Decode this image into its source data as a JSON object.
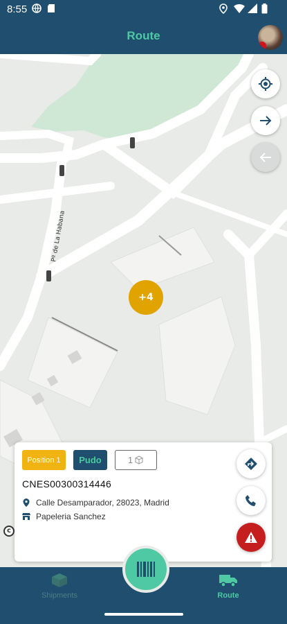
{
  "status_bar": {
    "time": "8:55"
  },
  "app_bar": {
    "title": "Route"
  },
  "map": {
    "street_label": "Pº de La Habana",
    "cluster_label": "+4"
  },
  "card": {
    "position_badge": "Position 1",
    "type_badge": "Pudo",
    "package_count": "1",
    "tracking_code": "CNES00300314446",
    "address": "Calle Desamparador, 28023, Madrid",
    "store_name": "Papeleria Sanchez"
  },
  "bottom_nav": {
    "items": [
      {
        "label": "Shipments",
        "active": false
      },
      {
        "label": "Route",
        "active": true
      }
    ]
  },
  "colors": {
    "primary": "#1f4e6e",
    "accent": "#4fc9a4",
    "warning": "#f0b311",
    "danger": "#c41e1e"
  }
}
